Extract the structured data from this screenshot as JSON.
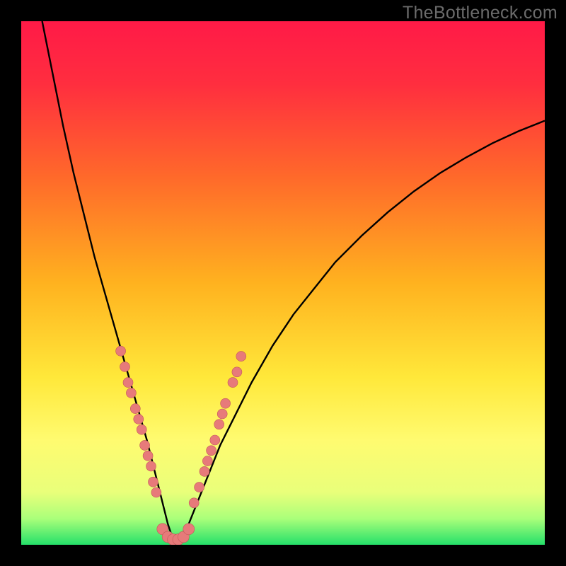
{
  "watermark": "TheBottleneck.com",
  "colors": {
    "gradient_stops": [
      {
        "offset": 0.0,
        "color": "#ff1a47"
      },
      {
        "offset": 0.12,
        "color": "#ff2e3f"
      },
      {
        "offset": 0.3,
        "color": "#ff6a2a"
      },
      {
        "offset": 0.5,
        "color": "#ffb21f"
      },
      {
        "offset": 0.68,
        "color": "#ffe83a"
      },
      {
        "offset": 0.8,
        "color": "#fffb70"
      },
      {
        "offset": 0.9,
        "color": "#e9ff7a"
      },
      {
        "offset": 0.95,
        "color": "#aaff7a"
      },
      {
        "offset": 1.0,
        "color": "#25e06a"
      }
    ],
    "curve": "#000000",
    "dot_fill": "#e77a7a",
    "dot_stroke": "#c05858",
    "bg": "#000000"
  },
  "chart_data": {
    "type": "line",
    "title": "",
    "xlabel": "",
    "ylabel": "",
    "ylim": [
      0,
      100
    ],
    "xlim": [
      0,
      100
    ],
    "curve_x": [
      4,
      6,
      8,
      10,
      12,
      14,
      16,
      18,
      20,
      22,
      24,
      25,
      26,
      27,
      28,
      29,
      30,
      32,
      34,
      36,
      38,
      40,
      44,
      48,
      52,
      56,
      60,
      65,
      70,
      75,
      80,
      85,
      90,
      95,
      100
    ],
    "curve_y": [
      100,
      90,
      80,
      71,
      63,
      55,
      48,
      41,
      34,
      27,
      20,
      16,
      12,
      8,
      4,
      1,
      1,
      4,
      9,
      14,
      19,
      23,
      31,
      38,
      44,
      49,
      54,
      59,
      63.5,
      67.5,
      71,
      74,
      76.7,
      79,
      81
    ],
    "dots_left": [
      {
        "x": 19.0,
        "y": 37
      },
      {
        "x": 19.8,
        "y": 34
      },
      {
        "x": 20.4,
        "y": 31
      },
      {
        "x": 21.0,
        "y": 29
      },
      {
        "x": 21.8,
        "y": 26
      },
      {
        "x": 22.4,
        "y": 24
      },
      {
        "x": 23.0,
        "y": 22
      },
      {
        "x": 23.6,
        "y": 19
      },
      {
        "x": 24.2,
        "y": 17
      },
      {
        "x": 24.8,
        "y": 15
      },
      {
        "x": 25.2,
        "y": 12
      },
      {
        "x": 25.8,
        "y": 10
      }
    ],
    "dots_bottom": [
      {
        "x": 27.0,
        "y": 3
      },
      {
        "x": 28.0,
        "y": 1.5
      },
      {
        "x": 29.0,
        "y": 1
      },
      {
        "x": 30.0,
        "y": 1
      },
      {
        "x": 31.0,
        "y": 1.5
      },
      {
        "x": 32.0,
        "y": 3
      }
    ],
    "dots_right": [
      {
        "x": 33.0,
        "y": 8
      },
      {
        "x": 34.0,
        "y": 11
      },
      {
        "x": 35.0,
        "y": 14
      },
      {
        "x": 35.6,
        "y": 16
      },
      {
        "x": 36.3,
        "y": 18
      },
      {
        "x": 37.0,
        "y": 20
      },
      {
        "x": 37.8,
        "y": 23
      },
      {
        "x": 38.4,
        "y": 25
      },
      {
        "x": 39.0,
        "y": 27
      },
      {
        "x": 40.4,
        "y": 31
      },
      {
        "x": 41.2,
        "y": 33
      },
      {
        "x": 42.0,
        "y": 36
      }
    ]
  }
}
